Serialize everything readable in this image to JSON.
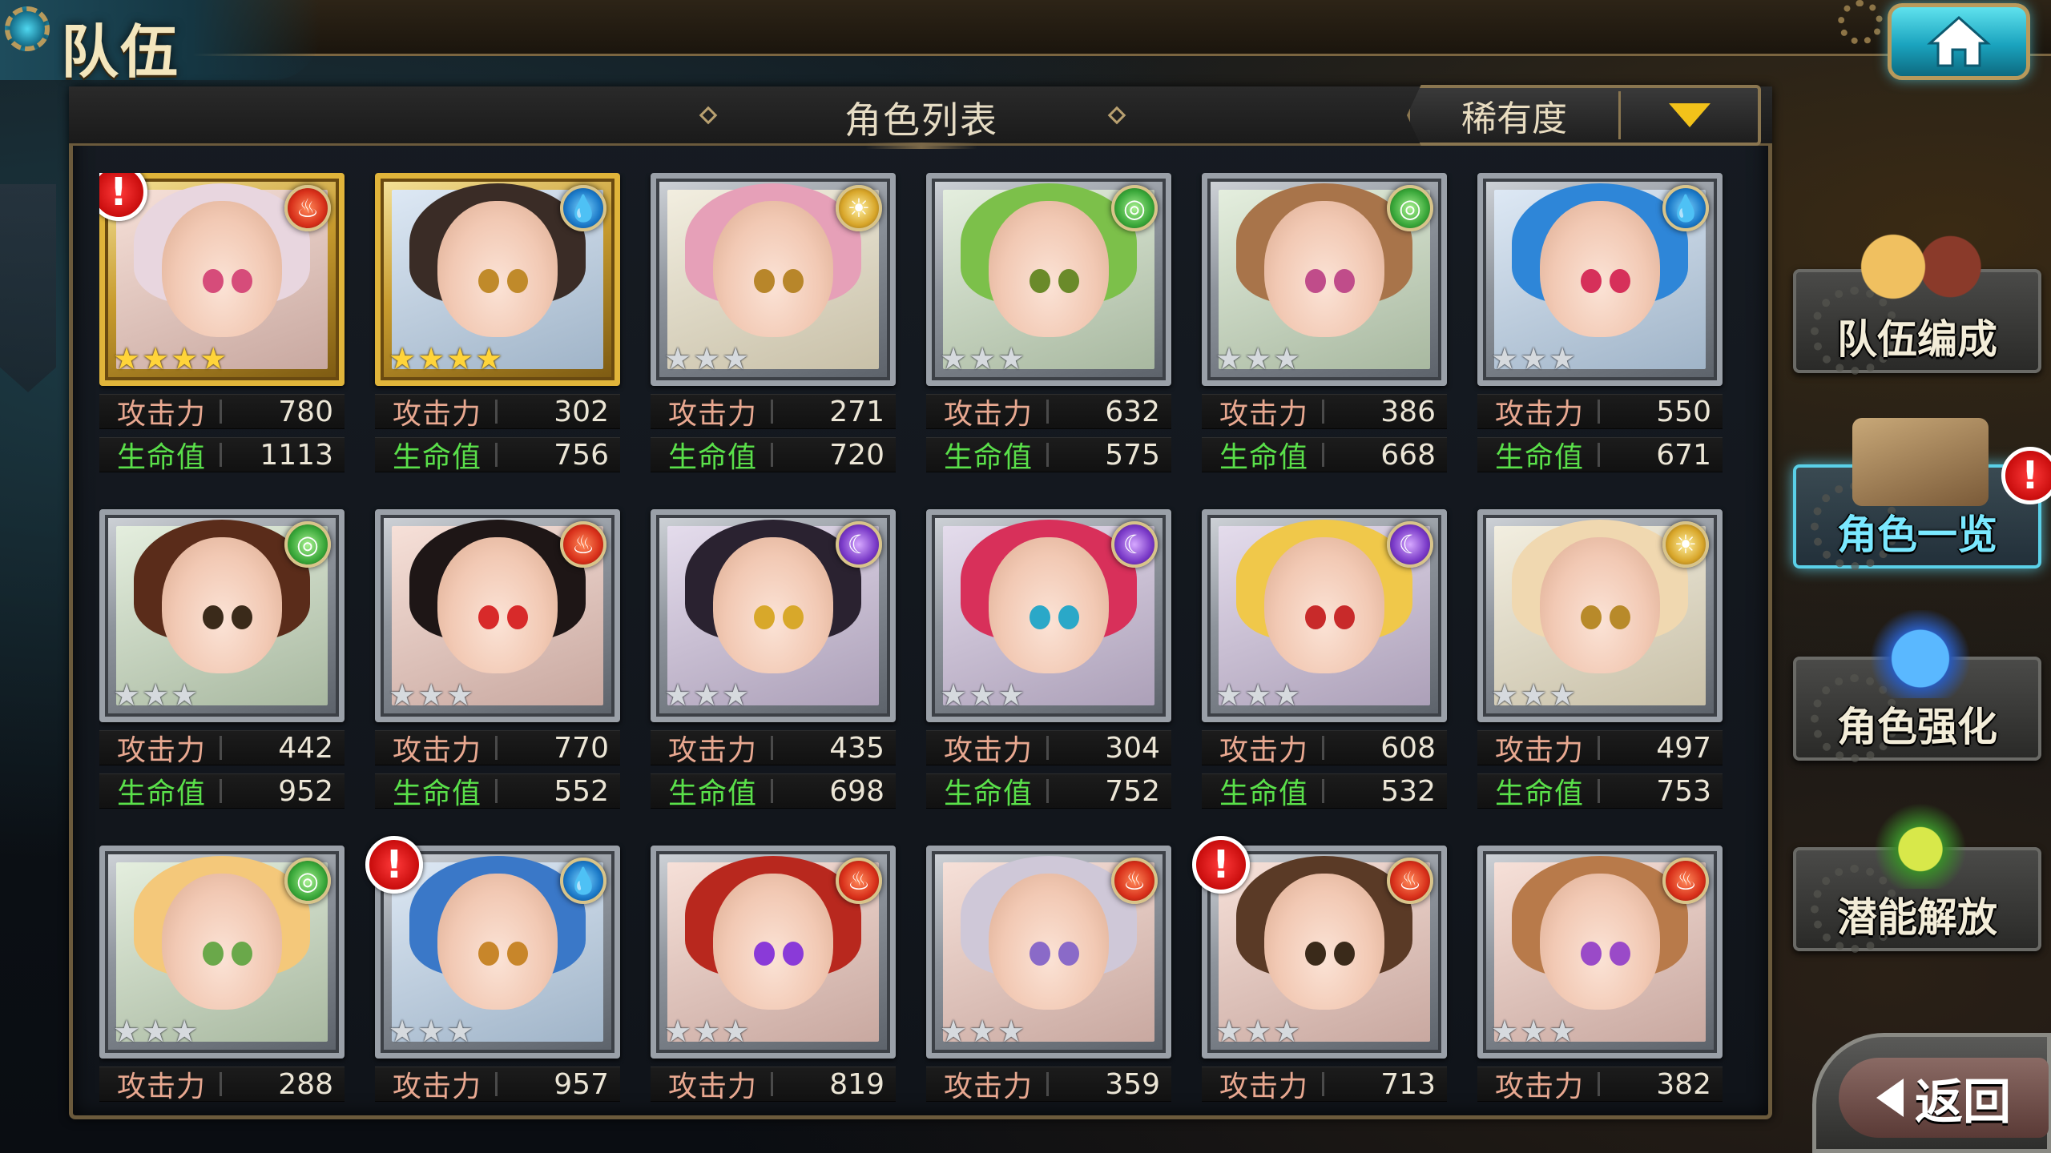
{
  "screen_title": "队伍",
  "list_title": "角色列表",
  "sort": {
    "label": "稀有度"
  },
  "stat_labels": {
    "attack": "攻击力",
    "hp": "生命值"
  },
  "characters": [
    {
      "element": "fire",
      "element_icon": "fire-icon",
      "stars": 4,
      "rarity": "gold",
      "alert": true,
      "attack": "780",
      "hp": "1113",
      "hair": "#e8d6df",
      "eye": "#d64c7a"
    },
    {
      "element": "water",
      "element_icon": "water-icon",
      "stars": 4,
      "rarity": "gold",
      "alert": false,
      "attack": "302",
      "hp": "756",
      "hair": "#3a2c26",
      "eye": "#c08a2a"
    },
    {
      "element": "light",
      "element_icon": "sun-icon",
      "stars": 3,
      "rarity": "silver",
      "alert": false,
      "attack": "271",
      "hp": "720",
      "hair": "#e6a0b8",
      "eye": "#b8862a"
    },
    {
      "element": "wind",
      "element_icon": "wind-icon",
      "stars": 3,
      "rarity": "silver",
      "alert": false,
      "attack": "632",
      "hp": "575",
      "hair": "#7cc04a",
      "eye": "#6a8a2a"
    },
    {
      "element": "wind",
      "element_icon": "wind-icon",
      "stars": 3,
      "rarity": "silver",
      "alert": false,
      "attack": "386",
      "hp": "668",
      "hair": "#a8744a",
      "eye": "#c04c8a"
    },
    {
      "element": "water",
      "element_icon": "water-icon",
      "stars": 3,
      "rarity": "silver",
      "alert": false,
      "attack": "550",
      "hp": "671",
      "hair": "#2e86d8",
      "eye": "#d6305a"
    },
    {
      "element": "wind",
      "element_icon": "wind-icon",
      "stars": 3,
      "rarity": "silver",
      "alert": false,
      "attack": "442",
      "hp": "952",
      "hair": "#5a2c1a",
      "eye": "#3a2a1a"
    },
    {
      "element": "fire",
      "element_icon": "fire-icon",
      "stars": 3,
      "rarity": "silver",
      "alert": false,
      "attack": "770",
      "hp": "552",
      "hair": "#1e1616",
      "eye": "#d82a2a"
    },
    {
      "element": "dark",
      "element_icon": "moon-icon",
      "stars": 3,
      "rarity": "silver",
      "alert": false,
      "attack": "435",
      "hp": "698",
      "hair": "#2a2230",
      "eye": "#d8a82a"
    },
    {
      "element": "dark",
      "element_icon": "moon-icon",
      "stars": 3,
      "rarity": "silver",
      "alert": false,
      "attack": "304",
      "hp": "752",
      "hair": "#d8305a",
      "eye": "#2aa8c8"
    },
    {
      "element": "dark",
      "element_icon": "moon-icon",
      "stars": 3,
      "rarity": "silver",
      "alert": false,
      "attack": "608",
      "hp": "532",
      "hair": "#f0c84a",
      "eye": "#c82a2a"
    },
    {
      "element": "light",
      "element_icon": "sun-icon",
      "stars": 3,
      "rarity": "silver",
      "alert": false,
      "attack": "497",
      "hp": "753",
      "hair": "#f0d8b0",
      "eye": "#b88a2a"
    },
    {
      "element": "wind",
      "element_icon": "wind-icon",
      "stars": 3,
      "rarity": "silver",
      "alert": false,
      "attack": "288",
      "hp": "",
      "hair": "#f4c87a",
      "eye": "#6aa84a"
    },
    {
      "element": "water",
      "element_icon": "water-icon",
      "stars": 3,
      "rarity": "silver",
      "alert": true,
      "attack": "957",
      "hp": "",
      "hair": "#3a78c8",
      "eye": "#c8862a"
    },
    {
      "element": "fire",
      "element_icon": "fire-icon",
      "stars": 3,
      "rarity": "silver",
      "alert": false,
      "attack": "819",
      "hp": "",
      "hair": "#b8281e",
      "eye": "#8a3ad8"
    },
    {
      "element": "fire",
      "element_icon": "fire-icon",
      "stars": 3,
      "rarity": "silver",
      "alert": false,
      "attack": "359",
      "hp": "",
      "hair": "#cfc8d8",
      "eye": "#8a6ac8"
    },
    {
      "element": "fire",
      "element_icon": "fire-icon",
      "stars": 3,
      "rarity": "silver",
      "alert": true,
      "attack": "713",
      "hp": "",
      "hair": "#5a3a26",
      "eye": "#3a2a1a"
    },
    {
      "element": "fire",
      "element_icon": "fire-icon",
      "stars": 3,
      "rarity": "silver",
      "alert": false,
      "attack": "382",
      "hp": "",
      "hair": "#b87a4a",
      "eye": "#9a4ac8"
    }
  ],
  "side_menu": [
    {
      "label": "队伍编成",
      "icon": "party-members-icon",
      "active": false,
      "alert": false
    },
    {
      "label": "角色一览",
      "icon": "book-icon",
      "active": true,
      "alert": true
    },
    {
      "label": "角色强化",
      "icon": "enhance-crystal-icon",
      "active": false,
      "alert": false
    },
    {
      "label": "潜能解放",
      "icon": "potential-orb-icon",
      "active": false,
      "alert": false
    }
  ],
  "back_label": "返回",
  "alert_symbol": "!",
  "colors": {
    "hp_label": "#5ae04a",
    "active_accent": "#5ad0e8",
    "sort_arrow": "#f2c21a",
    "alert": "#c80c0c"
  }
}
